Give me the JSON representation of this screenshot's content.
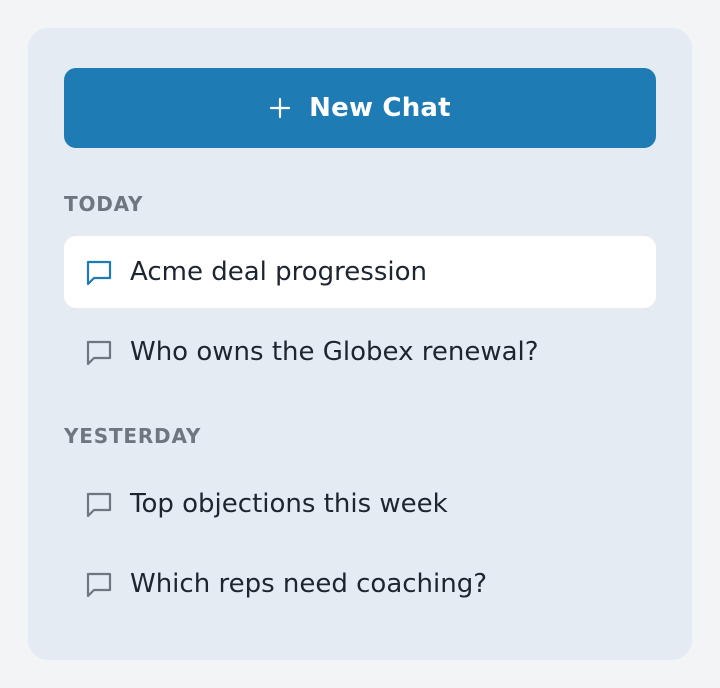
{
  "new_chat": {
    "label": "New Chat",
    "icon": "plus-icon"
  },
  "colors": {
    "accent": "#1f7bb4",
    "panel_bg": "#e4ebf3",
    "active_item_bg": "#ffffff",
    "section_label": "#6e7680",
    "item_text": "#1c2530",
    "inactive_icon": "#6e7680"
  },
  "sections": [
    {
      "label": "TODAY",
      "items": [
        {
          "title": "Acme deal progression",
          "icon": "chat-bubble-icon",
          "active": true
        },
        {
          "title": "Who owns the Globex renewal?",
          "icon": "chat-bubble-icon",
          "active": false
        }
      ]
    },
    {
      "label": "YESTERDAY",
      "items": [
        {
          "title": "Top objections this week",
          "icon": "chat-bubble-icon",
          "active": false
        },
        {
          "title": "Which reps need coaching?",
          "icon": "chat-bubble-icon",
          "active": false
        }
      ]
    }
  ]
}
